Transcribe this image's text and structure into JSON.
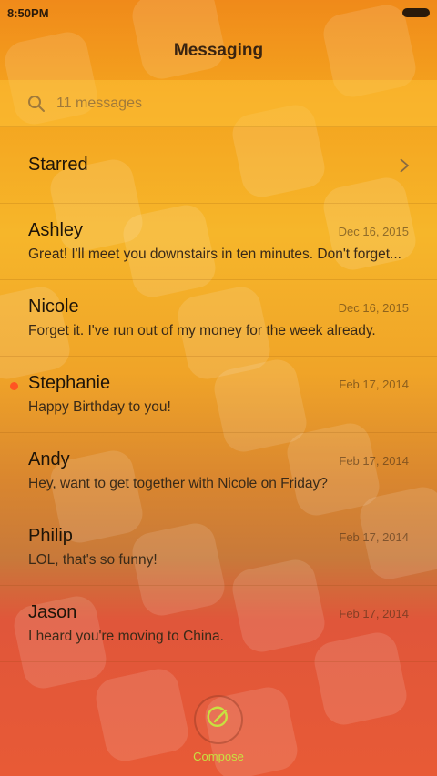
{
  "status_bar": {
    "time": "8:50PM"
  },
  "header": {
    "title": "Messaging"
  },
  "search": {
    "placeholder": "11 messages"
  },
  "starred": {
    "label": "Starred"
  },
  "messages": [
    {
      "name": "Ashley",
      "date": "Dec 16, 2015",
      "preview": "Great! I'll meet you downstairs in ten minutes. Don't forget...",
      "unread": false
    },
    {
      "name": "Nicole",
      "date": "Dec 16, 2015",
      "preview": "Forget it. I've run out of my money for the week already.",
      "unread": false
    },
    {
      "name": "Stephanie",
      "date": "Feb 17, 2014",
      "preview": "Happy Birthday to you!",
      "unread": true
    },
    {
      "name": "Andy",
      "date": "Feb 17, 2014",
      "preview": "Hey, want to get together with Nicole on Friday?",
      "unread": false
    },
    {
      "name": "Philip",
      "date": "Feb 17, 2014",
      "preview": "LOL, that's so funny!",
      "unread": false
    },
    {
      "name": "Jason",
      "date": "Feb 17, 2014",
      "preview": "I heard you're moving to China.",
      "unread": false
    }
  ],
  "compose": {
    "label": "Compose"
  },
  "colors": {
    "accent": "#c8e040",
    "unread_dot": "#ff5522",
    "title": "#3a2410"
  },
  "icons": {
    "search": "search-icon",
    "chevron": "chevron-right-icon",
    "compose": "compose-icon",
    "battery": "battery-icon"
  }
}
